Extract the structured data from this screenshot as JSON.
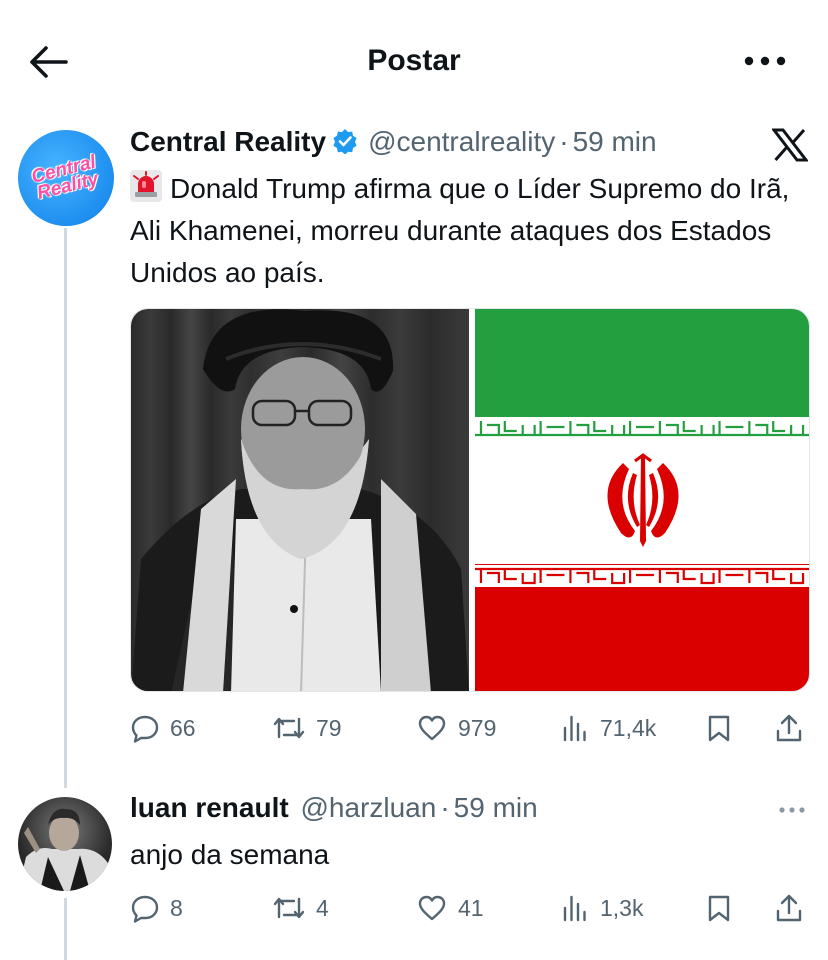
{
  "header": {
    "title": "Postar",
    "back_icon": "arrow-left-icon",
    "more_icon": "more-horizontal-icon"
  },
  "main_post": {
    "author_name": "Central Reality",
    "avatar_text": "Central Reality",
    "verified": true,
    "handle": "@centralreality",
    "separator": "·",
    "time": "59 min",
    "emoji_icon": "police-light-icon",
    "text": "Donald Trump afirma que o Líder Supremo do Irã, Ali Khamenei, morreu durante ataques dos Estados Unidos ao país.",
    "media": [
      "portrait-photo",
      "iran-flag"
    ],
    "stats": {
      "replies": "66",
      "reposts": "79",
      "likes": "979",
      "views": "71,4k"
    }
  },
  "reply_post": {
    "author_name": "luan renault",
    "handle": "@harzluan",
    "separator": "·",
    "time": "59 min",
    "text": "anjo da semana",
    "stats": {
      "replies": "8",
      "reposts": "4",
      "likes": "41",
      "views": "1,3k"
    }
  },
  "colors": {
    "text_primary": "#0f1419",
    "text_secondary": "#536471",
    "verified_blue": "#1d9bf0",
    "thread_line": "#cfd9de",
    "flag_green": "#239f40",
    "flag_red": "#da0000"
  }
}
